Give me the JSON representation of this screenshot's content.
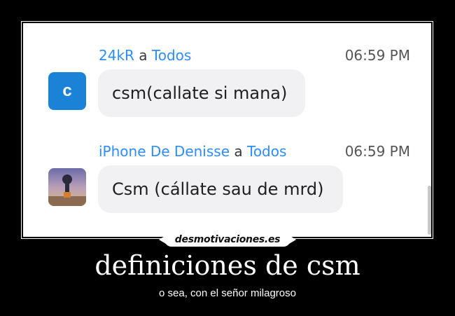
{
  "chat": {
    "messages": [
      {
        "sender": "24kR",
        "connector": "a",
        "recipient": "Todos",
        "time": "06:59 PM",
        "avatar_letter": "c",
        "text": "csm(callate si mana)"
      },
      {
        "sender": "iPhone De Denisse",
        "connector": "a",
        "recipient": "Todos",
        "time": "06:59 PM",
        "avatar_letter": "",
        "text": "Csm (cállate sau de mrd)"
      }
    ]
  },
  "poster": {
    "site": "desmotivaciones.es",
    "title": "definiciones de csm",
    "subtitle": "o sea, con el señor milagroso"
  },
  "colors": {
    "sender_blue": "#2D8CFF",
    "avatar_blue": "#1a83d8",
    "bubble_bg": "#f1f1f4",
    "background": "#000000"
  },
  "icons": {
    "avatar1": "letter-avatar-icon",
    "avatar2": "photo-avatar-icon"
  }
}
